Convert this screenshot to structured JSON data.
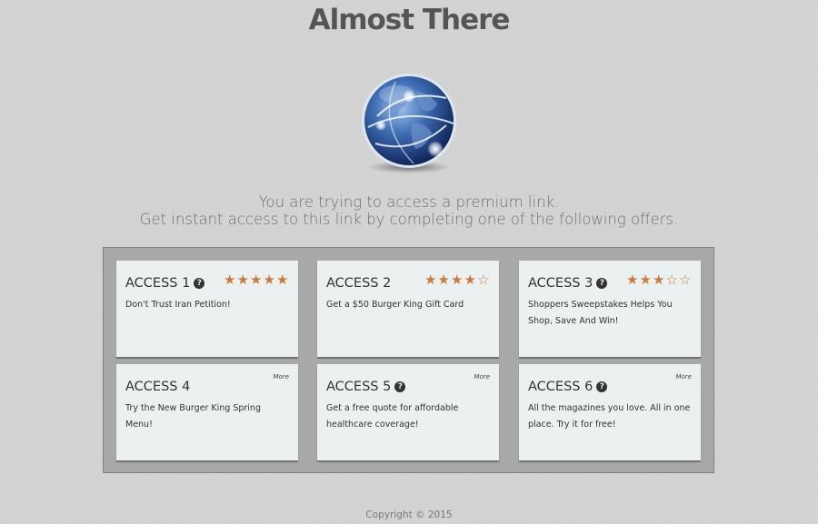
{
  "page": {
    "title": "Almost There",
    "subtitle_line1": "You are trying to access a premium link.",
    "subtitle_line2": "Get instant access to this link by completing one of the following offers.",
    "globe_icon": "globe-icon",
    "copyright": "Copyright © 2015"
  },
  "colors": {
    "background": "#d2d2d2",
    "panel": "#a9a9a9",
    "card": "#ebf0f0",
    "star": "#cc7a36",
    "title": "#555555"
  },
  "offers": [
    {
      "title": "ACCESS 1",
      "help": "?",
      "rating": 5,
      "more": "",
      "desc": "Don't Trust Iran Petition!"
    },
    {
      "title": "ACCESS 2",
      "help": "",
      "rating": 4,
      "more": "",
      "desc": "Get a $50 Burger King Gift Card"
    },
    {
      "title": "ACCESS 3",
      "help": "?",
      "rating": 3,
      "more": "",
      "desc": "Shoppers Sweepstakes Helps You Shop, Save And Win!"
    },
    {
      "title": "ACCESS 4",
      "help": "",
      "rating": null,
      "more": "More",
      "desc": "Try the New Burger King Spring Menu!"
    },
    {
      "title": "ACCESS 5",
      "help": "?",
      "rating": null,
      "more": "More",
      "desc": "Get a free quote for affordable healthcare coverage!"
    },
    {
      "title": "ACCESS 6",
      "help": "?",
      "rating": null,
      "more": "More",
      "desc": "All the magazines you love. All in one place. Try it for free!"
    }
  ]
}
